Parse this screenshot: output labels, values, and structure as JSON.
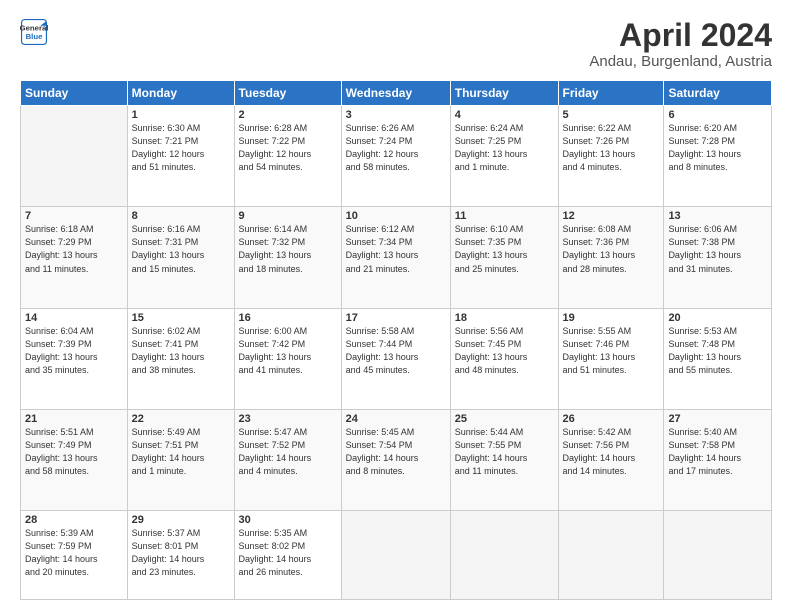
{
  "header": {
    "logo_line1": "General",
    "logo_line2": "Blue",
    "month": "April 2024",
    "location": "Andau, Burgenland, Austria"
  },
  "weekdays": [
    "Sunday",
    "Monday",
    "Tuesday",
    "Wednesday",
    "Thursday",
    "Friday",
    "Saturday"
  ],
  "weeks": [
    [
      {
        "day": "",
        "info": ""
      },
      {
        "day": "1",
        "info": "Sunrise: 6:30 AM\nSunset: 7:21 PM\nDaylight: 12 hours\nand 51 minutes."
      },
      {
        "day": "2",
        "info": "Sunrise: 6:28 AM\nSunset: 7:22 PM\nDaylight: 12 hours\nand 54 minutes."
      },
      {
        "day": "3",
        "info": "Sunrise: 6:26 AM\nSunset: 7:24 PM\nDaylight: 12 hours\nand 58 minutes."
      },
      {
        "day": "4",
        "info": "Sunrise: 6:24 AM\nSunset: 7:25 PM\nDaylight: 13 hours\nand 1 minute."
      },
      {
        "day": "5",
        "info": "Sunrise: 6:22 AM\nSunset: 7:26 PM\nDaylight: 13 hours\nand 4 minutes."
      },
      {
        "day": "6",
        "info": "Sunrise: 6:20 AM\nSunset: 7:28 PM\nDaylight: 13 hours\nand 8 minutes."
      }
    ],
    [
      {
        "day": "7",
        "info": "Sunrise: 6:18 AM\nSunset: 7:29 PM\nDaylight: 13 hours\nand 11 minutes."
      },
      {
        "day": "8",
        "info": "Sunrise: 6:16 AM\nSunset: 7:31 PM\nDaylight: 13 hours\nand 15 minutes."
      },
      {
        "day": "9",
        "info": "Sunrise: 6:14 AM\nSunset: 7:32 PM\nDaylight: 13 hours\nand 18 minutes."
      },
      {
        "day": "10",
        "info": "Sunrise: 6:12 AM\nSunset: 7:34 PM\nDaylight: 13 hours\nand 21 minutes."
      },
      {
        "day": "11",
        "info": "Sunrise: 6:10 AM\nSunset: 7:35 PM\nDaylight: 13 hours\nand 25 minutes."
      },
      {
        "day": "12",
        "info": "Sunrise: 6:08 AM\nSunset: 7:36 PM\nDaylight: 13 hours\nand 28 minutes."
      },
      {
        "day": "13",
        "info": "Sunrise: 6:06 AM\nSunset: 7:38 PM\nDaylight: 13 hours\nand 31 minutes."
      }
    ],
    [
      {
        "day": "14",
        "info": "Sunrise: 6:04 AM\nSunset: 7:39 PM\nDaylight: 13 hours\nand 35 minutes."
      },
      {
        "day": "15",
        "info": "Sunrise: 6:02 AM\nSunset: 7:41 PM\nDaylight: 13 hours\nand 38 minutes."
      },
      {
        "day": "16",
        "info": "Sunrise: 6:00 AM\nSunset: 7:42 PM\nDaylight: 13 hours\nand 41 minutes."
      },
      {
        "day": "17",
        "info": "Sunrise: 5:58 AM\nSunset: 7:44 PM\nDaylight: 13 hours\nand 45 minutes."
      },
      {
        "day": "18",
        "info": "Sunrise: 5:56 AM\nSunset: 7:45 PM\nDaylight: 13 hours\nand 48 minutes."
      },
      {
        "day": "19",
        "info": "Sunrise: 5:55 AM\nSunset: 7:46 PM\nDaylight: 13 hours\nand 51 minutes."
      },
      {
        "day": "20",
        "info": "Sunrise: 5:53 AM\nSunset: 7:48 PM\nDaylight: 13 hours\nand 55 minutes."
      }
    ],
    [
      {
        "day": "21",
        "info": "Sunrise: 5:51 AM\nSunset: 7:49 PM\nDaylight: 13 hours\nand 58 minutes."
      },
      {
        "day": "22",
        "info": "Sunrise: 5:49 AM\nSunset: 7:51 PM\nDaylight: 14 hours\nand 1 minute."
      },
      {
        "day": "23",
        "info": "Sunrise: 5:47 AM\nSunset: 7:52 PM\nDaylight: 14 hours\nand 4 minutes."
      },
      {
        "day": "24",
        "info": "Sunrise: 5:45 AM\nSunset: 7:54 PM\nDaylight: 14 hours\nand 8 minutes."
      },
      {
        "day": "25",
        "info": "Sunrise: 5:44 AM\nSunset: 7:55 PM\nDaylight: 14 hours\nand 11 minutes."
      },
      {
        "day": "26",
        "info": "Sunrise: 5:42 AM\nSunset: 7:56 PM\nDaylight: 14 hours\nand 14 minutes."
      },
      {
        "day": "27",
        "info": "Sunrise: 5:40 AM\nSunset: 7:58 PM\nDaylight: 14 hours\nand 17 minutes."
      }
    ],
    [
      {
        "day": "28",
        "info": "Sunrise: 5:39 AM\nSunset: 7:59 PM\nDaylight: 14 hours\nand 20 minutes."
      },
      {
        "day": "29",
        "info": "Sunrise: 5:37 AM\nSunset: 8:01 PM\nDaylight: 14 hours\nand 23 minutes."
      },
      {
        "day": "30",
        "info": "Sunrise: 5:35 AM\nSunset: 8:02 PM\nDaylight: 14 hours\nand 26 minutes."
      },
      {
        "day": "",
        "info": ""
      },
      {
        "day": "",
        "info": ""
      },
      {
        "day": "",
        "info": ""
      },
      {
        "day": "",
        "info": ""
      }
    ]
  ]
}
